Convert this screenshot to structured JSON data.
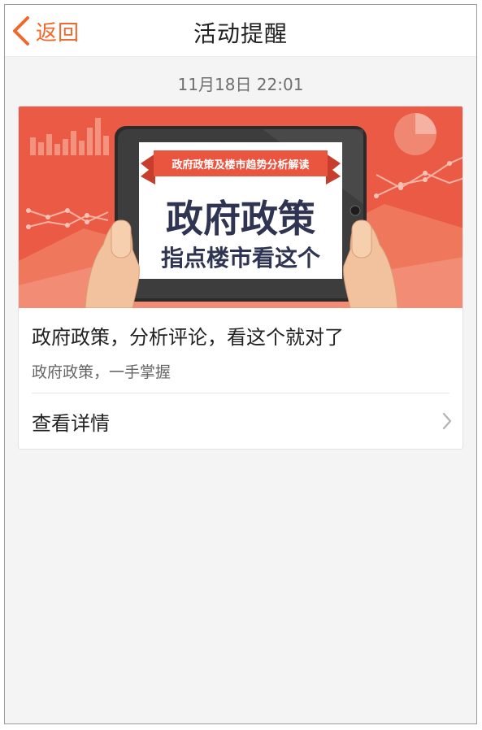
{
  "header": {
    "back_label": "返回",
    "title": "活动提醒"
  },
  "timestamp": "11月18日 22:01",
  "card": {
    "banner": {
      "ribbon_text": "政府政策及楼市趋势分析解读",
      "headline": "政府政策",
      "subline": "指点楼市看这个"
    },
    "title": "政府政策，分析评论，看这个就对了",
    "subtitle": "政府政策，一手掌握",
    "details_label": "查看详情"
  },
  "colors": {
    "accent": "#f0682a",
    "banner_bg": "#ea5a44",
    "page_bg": "#f4f4f4",
    "headline": "#2f3452"
  }
}
